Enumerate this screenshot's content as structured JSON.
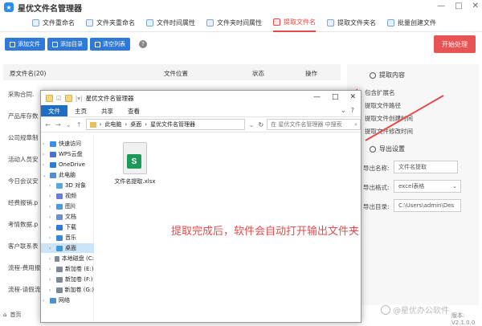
{
  "app": {
    "title": "星优文件名管理器",
    "window_controls": [
      "—",
      "□",
      "✕"
    ]
  },
  "tabs": [
    {
      "label": "文件重命名",
      "active": false
    },
    {
      "label": "文件夹重命名",
      "active": false
    },
    {
      "label": "文件时间属性",
      "active": false
    },
    {
      "label": "文件夹时间属性",
      "active": false
    },
    {
      "label": "提取文件名",
      "active": true
    },
    {
      "label": "提取文件夹名",
      "active": false
    },
    {
      "label": "批量创建文件",
      "active": false
    }
  ],
  "toolbar": {
    "add_file": "添加文件",
    "add_folder": "添加目录",
    "clear_list": "清空列表",
    "help": "?",
    "start": "开始处理"
  },
  "table": {
    "headers": [
      "原文件名(20)",
      "文件位置",
      "状态",
      "操作"
    ],
    "rows": [
      "采购合同.",
      "产品库存数",
      "公司规章制",
      "活动人员安",
      "今日会议安",
      "经费报销.p",
      "考情数据.p",
      "客户联系表",
      "流程-费用报",
      "流程-请假流"
    ]
  },
  "right_panel": {
    "extract_title": "提取内容",
    "options": [
      "包含扩展名",
      "提取文件路径",
      "提取文件创建时间",
      "提取文件修改时间"
    ],
    "export_title": "导出设置",
    "export_name_label": "导出名称:",
    "export_name_value": "文件名提取",
    "export_format_label": "导出格式:",
    "export_format_value": "excel表格",
    "export_dir_label": "导出目录:",
    "export_dir_value": "C:\\Users\\admin\\Des",
    "version": "版本: V2.1.0.0"
  },
  "bottom": {
    "home": "首页"
  },
  "explorer": {
    "title": "星优文件名管理器",
    "ribbon_tabs": [
      "文件",
      "主页",
      "共享",
      "查看"
    ],
    "path": [
      "此电脑",
      "桌面",
      "星优文件名管理器"
    ],
    "search_placeholder": "在 星优文件名管理器 中搜索",
    "nav": [
      {
        "label": "快速访问",
        "indent": 1,
        "color": "#3d8ee6",
        "chev": ">"
      },
      {
        "label": "WPS云盘",
        "indent": 1,
        "color": "#4c6fd0",
        "chev": ">"
      },
      {
        "label": "OneDrive",
        "indent": 1,
        "color": "#2a7ed6",
        "chev": ">"
      },
      {
        "label": "此电脑",
        "indent": 1,
        "color": "#4e8fd1",
        "chev": "v"
      },
      {
        "label": "3D 对象",
        "indent": 2,
        "color": "#5aa7e0",
        "chev": ">"
      },
      {
        "label": "视频",
        "indent": 2,
        "color": "#6c7bd6",
        "chev": ">"
      },
      {
        "label": "图片",
        "indent": 2,
        "color": "#4e9ad6",
        "chev": ">"
      },
      {
        "label": "文档",
        "indent": 2,
        "color": "#6c8fc7",
        "chev": ">"
      },
      {
        "label": "下载",
        "indent": 2,
        "color": "#2f7ad8",
        "chev": ">"
      },
      {
        "label": "音乐",
        "indent": 2,
        "color": "#3a86d6",
        "chev": ">"
      },
      {
        "label": "桌面",
        "indent": 2,
        "color": "#3f9ad8",
        "chev": ">",
        "selected": true
      },
      {
        "label": "本地磁盘 (C:",
        "indent": 2,
        "color": "#7d8a96",
        "chev": ">"
      },
      {
        "label": "新加卷 (E:)",
        "indent": 2,
        "color": "#7d8a96",
        "chev": ">"
      },
      {
        "label": "新加卷 (F:)",
        "indent": 2,
        "color": "#7d8a96",
        "chev": ">"
      },
      {
        "label": "新加卷 (G:)",
        "indent": 2,
        "color": "#7d8a96",
        "chev": ">"
      },
      {
        "label": "网络",
        "indent": 1,
        "color": "#4e8fd1",
        "chev": ">"
      }
    ],
    "file_name": "文件名提取.xlsx",
    "file_badge": "S",
    "note": "提取完成后，软件会自动打开输出文件夹"
  },
  "watermark": "@星优办公软件",
  "colors": {
    "accent_red": "#e85454",
    "toolbar_blue": "#2f7ad8",
    "excel_green": "#1d9a5a"
  }
}
